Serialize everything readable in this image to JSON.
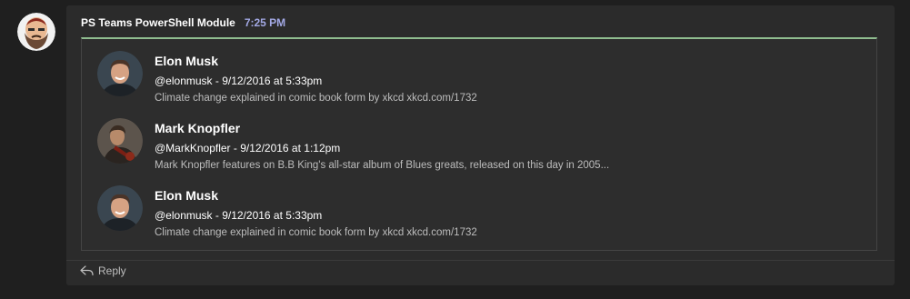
{
  "post": {
    "sender": "PS Teams PowerShell Module",
    "time": "7:25 PM",
    "sender_avatar_icon": "bearded-character-avatar-icon"
  },
  "card": {
    "accent_color": "#8fbc8f",
    "tweets": [
      {
        "name": "Elon Musk",
        "meta": "@elonmusk - 9/12/2016 at 5:33pm",
        "text": "Climate change explained in comic book form by xkcd xkcd.com/1732",
        "avatar": "elon-musk-avatar"
      },
      {
        "name": "Mark Knopfler",
        "meta": "@MarkKnopfler - 9/12/2016 at 1:12pm",
        "text": "Mark Knopfler features on B.B King's all-star album of Blues greats, released on this day in 2005...",
        "avatar": "mark-knopfler-avatar"
      },
      {
        "name": "Elon Musk",
        "meta": "@elonmusk - 9/12/2016 at 5:33pm",
        "text": "Climate change explained in comic book form by xkcd xkcd.com/1732",
        "avatar": "elon-musk-avatar"
      }
    ]
  },
  "actions": {
    "reply_label": "Reply",
    "reply_icon": "reply-arrow-icon"
  },
  "colors": {
    "background": "#1f1f1f",
    "post_background": "#2b2b2b",
    "timestamp": "#a3a9e5"
  }
}
